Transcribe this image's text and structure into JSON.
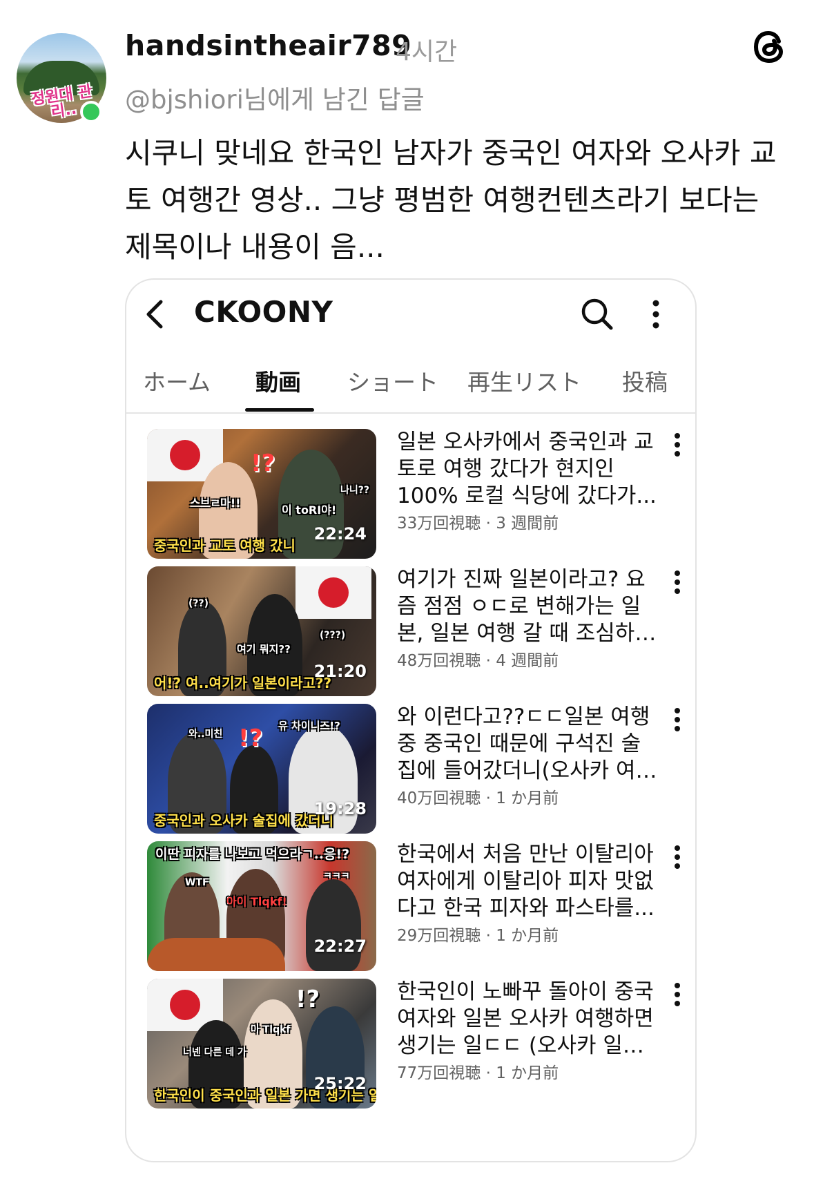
{
  "post": {
    "username": "handsintheair789",
    "time": "4시간",
    "reply_to": "@bjshiori님에게 남긴 답글",
    "avatar_sticker": "정원대 관리..",
    "text": "시쿠니 맞네요 한국인 남자가 중국인 여자와 오사카 교토 여행간 영상.. 그냥 평범한 여행컨텐츠라기 보다는 제목이나 내용이 음..."
  },
  "youtube": {
    "channel_name": "CKOONY",
    "tabs": [
      "ホーム",
      "動画",
      "ショート",
      "再生リスト",
      "投稿"
    ],
    "active_tab": "動画",
    "videos": [
      {
        "title": "일본 오사카에서 중국인과 교토로 여행 갔다가 현지인 100% 로컬 식당에 갔다가...",
        "meta": "33万回視聴 · 3 週間前",
        "duration": "22:24",
        "thumb_caption": "중국인과 교토 여행 갔니",
        "thumb_labels": [
          "!?",
          "스브ㄹ마!!",
          "이 toRI야!",
          "나니??"
        ]
      },
      {
        "title": "여기가 진짜 일본이라고? 요즘 점점 ㅇㄷ로 변해가는 일본, 일본 여행 갈 때 조심하…",
        "meta": "48万回視聴 · 4 週間前",
        "duration": "21:20",
        "thumb_caption": "어!? 여..여기가 일본이라고??",
        "thumb_labels": [
          "(??)",
          "여기 뭐지??",
          "(???)"
        ]
      },
      {
        "title": "와 이런다고??ㄷㄷ일본 여행 중 중국인 때문에 구석진 술집에 들어갔더니(오사카 여…",
        "meta": "40万回視聴 · 1 か月前",
        "duration": "19:28",
        "thumb_caption": "중국인과 오사카 술집에 갔더니",
        "thumb_labels": [
          "유 차이니즈!?",
          "와..미친",
          "!?"
        ]
      },
      {
        "title": "한국에서 처음 만난 이탈리아 여자에게 이탈리아 피자 맛없다고 한국 피자와 파스타를...",
        "meta": "29万回視聴 · 1 か月前",
        "duration": "22:27",
        "thumb_caption": "이딴 피자를 나보고 먹으라ㄱ..응!?",
        "thumb_labels": [
          "WTF",
          "아이 Tlqkf!",
          "ㅋㅋㅋ"
        ]
      },
      {
        "title": "한국인이 노빠꾸 돌아이 중국여자와 일본 오사카 여행하면 생기는 일ㄷㄷ (오사카 일…",
        "meta": "77万回視聴 · 1 か月前",
        "duration": "25:22",
        "thumb_caption": "한국인이 중국인과 일본 가면 생기는 일",
        "thumb_labels": [
          "!?",
          "너넨 다른 데 가",
          "아 Tlqkf"
        ]
      }
    ]
  },
  "colors": {
    "online": "#35c759",
    "muted_text": "#8f8f8f",
    "flag_red": "#d61d2b",
    "caption_yellow": "#ffe04a"
  }
}
